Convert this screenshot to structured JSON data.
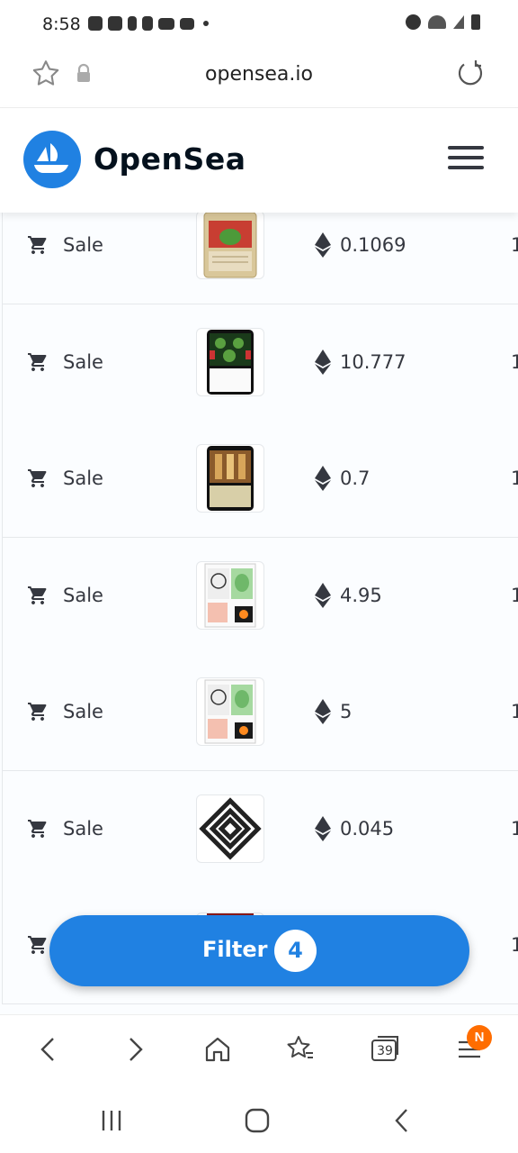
{
  "status_bar": {
    "time": "8:58",
    "left_icons": [
      "discord-icon",
      "discord-icon",
      "phone-icon",
      "tiktok-icon",
      "youtube-icon",
      "twitter-icon",
      "dot-icon"
    ],
    "right_icons": [
      "alarm-icon",
      "wifi-icon",
      "signal-icon",
      "battery-icon"
    ]
  },
  "browser": {
    "url": "opensea.io",
    "tab_count": "39",
    "menu_badge": "N"
  },
  "header": {
    "brand": "OpenSea",
    "brand_color": "#2081e2"
  },
  "activity": {
    "rows": [
      {
        "event": "Sale",
        "price": "0.1069",
        "trail": "1",
        "thumb": "pepe-card-tan"
      },
      {
        "event": "Sale",
        "price": "10.777",
        "trail": "1",
        "thumb": "pepe-card-dark"
      },
      {
        "event": "Sale",
        "price": "0.7",
        "trail": "1",
        "thumb": "church-card"
      },
      {
        "event": "Sale",
        "price": "4.95",
        "trail": "1",
        "thumb": "portrait-pepe-card"
      },
      {
        "event": "Sale",
        "price": "5",
        "trail": "1",
        "thumb": "portrait-pepe-card"
      },
      {
        "event": "Sale",
        "price": "0.045",
        "trail": "1",
        "thumb": "geometric-knot"
      },
      {
        "event": "",
        "price": "",
        "trail": "1",
        "thumb": "red-card-partial"
      }
    ]
  },
  "filter": {
    "label": "Filter",
    "count": "4"
  }
}
